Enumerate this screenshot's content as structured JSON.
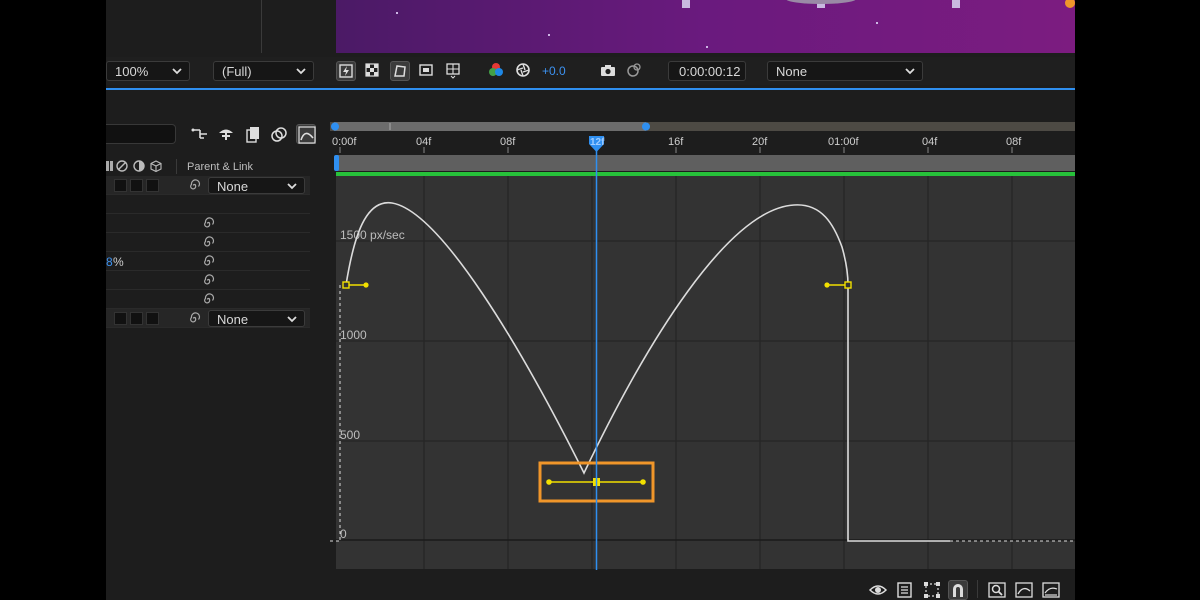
{
  "toolbar": {
    "zoom": "100%",
    "resolution": "(Full)",
    "exposure": "+0.0",
    "timecode": "0:00:00:12",
    "view_option": "None"
  },
  "layers_panel": {
    "parent_link_header": "Parent & Link",
    "parent_values": [
      "None",
      "None"
    ],
    "partial_value": "8",
    "partial_value_unit": "%"
  },
  "timeline": {
    "ruler_ticks": [
      "0:00f",
      "04f",
      "08f",
      "",
      "16f",
      "20f",
      "01:00f",
      "04f",
      "08f"
    ],
    "playhead_label": "12f"
  },
  "graph": {
    "unit_label": "1500 px/sec",
    "y_labels": [
      "1000",
      "500",
      "0"
    ]
  },
  "colors": {
    "accent_blue": "#2f8ff0",
    "keyframe_yellow": "#f2e000",
    "highlight_orange": "#f0962a",
    "work_area_green": "#27c23a",
    "panel_bg": "#1d1d1d",
    "graph_bg": "#333333"
  }
}
